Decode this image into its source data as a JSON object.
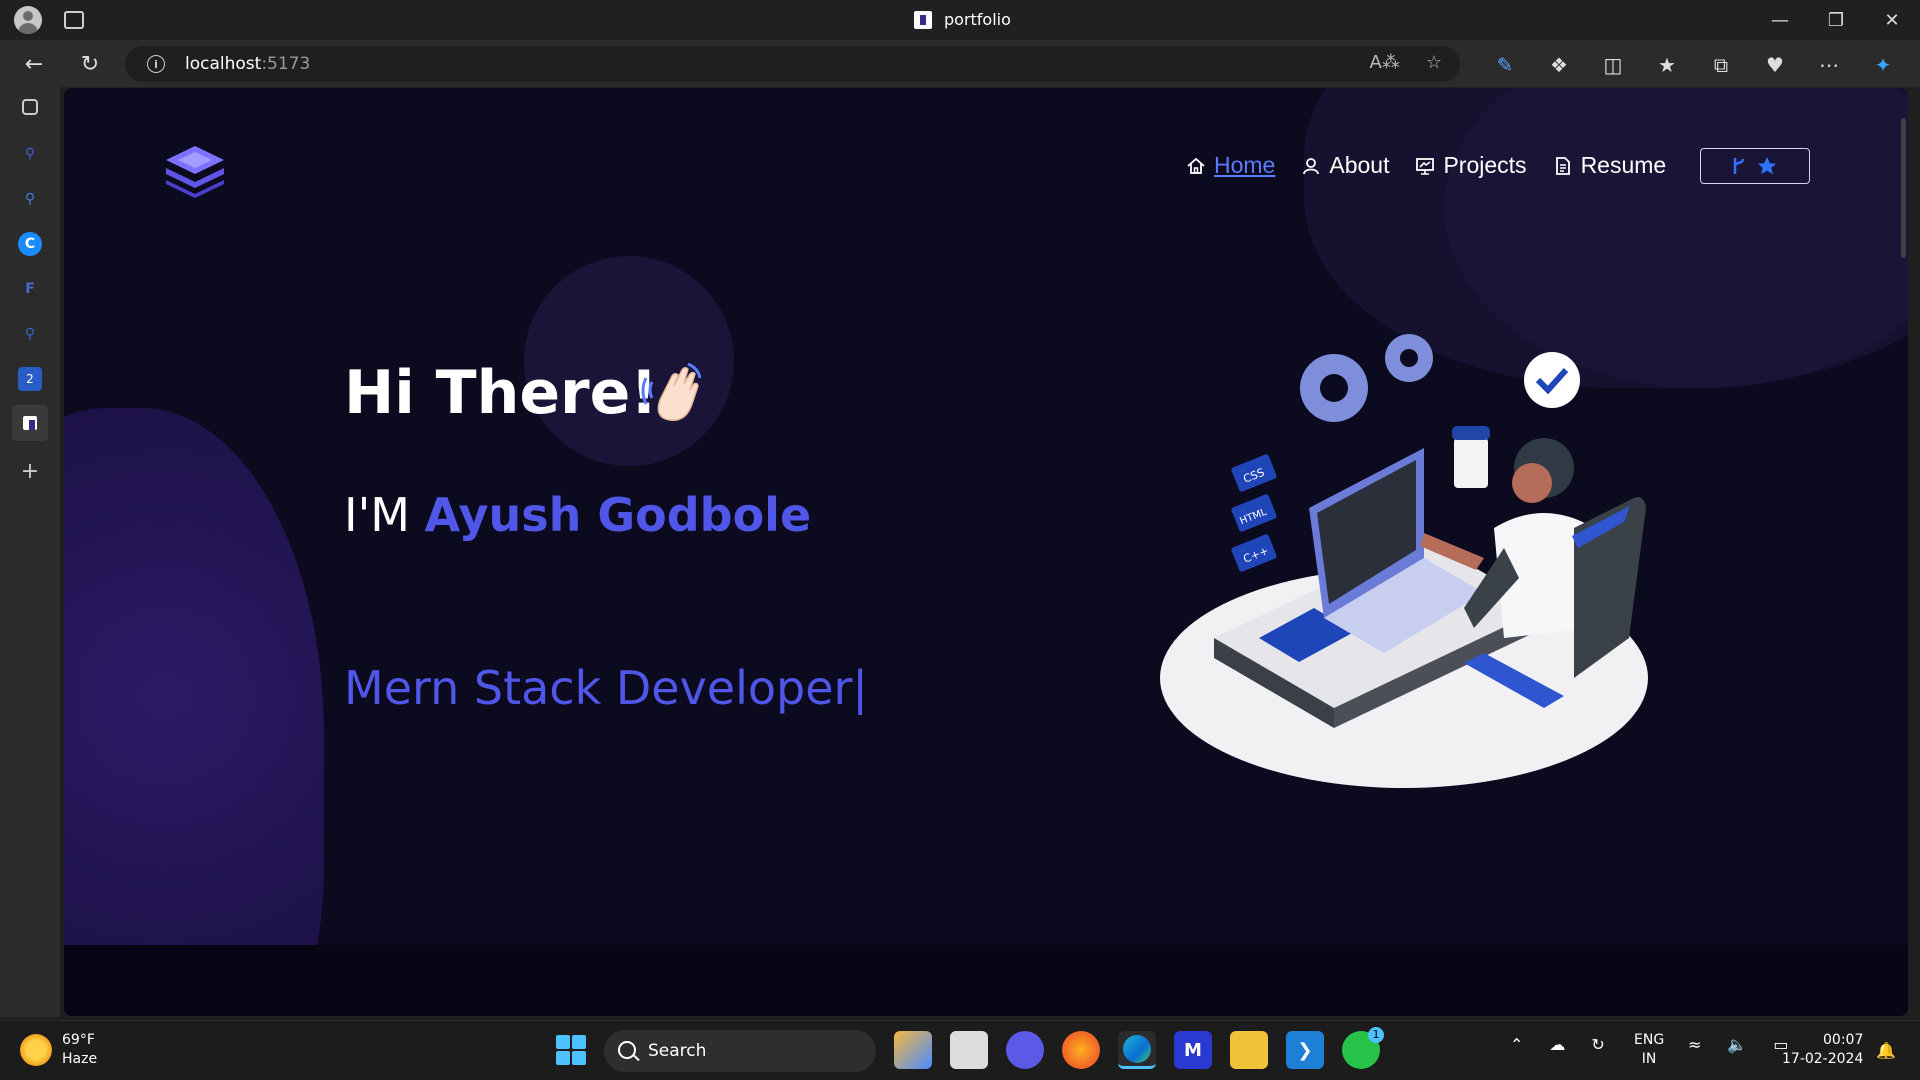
{
  "browser": {
    "tab_title": "portfolio",
    "url_host": "localhost",
    "url_port": ":5173"
  },
  "nav": {
    "items": [
      {
        "label": "Home",
        "icon": "home-icon",
        "active": true
      },
      {
        "label": "About",
        "icon": "user-icon",
        "active": false
      },
      {
        "label": "Projects",
        "icon": "projects-icon",
        "active": false
      },
      {
        "label": "Resume",
        "icon": "document-icon",
        "active": false
      }
    ],
    "github_button": {
      "icons": [
        "fork-icon",
        "star-icon"
      ]
    }
  },
  "hero": {
    "greeting": "Hi There!",
    "intro_prefix": "I'M ",
    "name": "Ayush Godbole",
    "role": "Mern Stack Developer|"
  },
  "illustration": {
    "badges": [
      "CSS",
      "HTML",
      "C++"
    ]
  },
  "taskbar": {
    "weather_temp": "69°F",
    "weather_desc": "Haze",
    "search_label": "Search",
    "lang_1": "ENG",
    "lang_2": "IN",
    "time": "00:07",
    "date": "17-02-2024",
    "whatsapp_badge": "1"
  },
  "colors": {
    "accent": "#4f56e8",
    "link": "#5b7bff",
    "page_bg": "#0c0a1f"
  }
}
